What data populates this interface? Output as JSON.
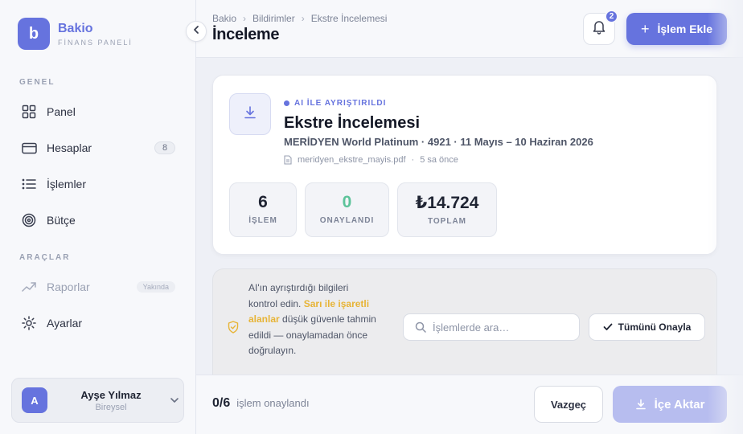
{
  "brand": {
    "logo_letter": "b",
    "name": "Bakio",
    "subtitle": "FİNANS PANELİ",
    "accent": "#6673de"
  },
  "sidebar": {
    "section_general": "GENEL",
    "section_tools": "ARAÇLAR",
    "items": [
      {
        "label": "Panel",
        "icon": "grid-icon"
      },
      {
        "label": "Hesaplar",
        "icon": "card-icon",
        "badge": "8"
      },
      {
        "label": "İşlemler",
        "icon": "list-icon"
      },
      {
        "label": "Bütçe",
        "icon": "target-icon"
      },
      {
        "label": "Raporlar",
        "icon": "trend-icon",
        "badge": "Yakında",
        "disabled": true
      },
      {
        "label": "Ayarlar",
        "icon": "gear-icon"
      }
    ]
  },
  "user": {
    "initial": "A",
    "name": "Ayşe Yılmaz",
    "role": "Bireysel"
  },
  "header": {
    "breadcrumb": [
      "Bakio",
      "Bildirimler",
      "Ekstre İncelemesi"
    ],
    "title": "İnceleme",
    "notification_count": "2",
    "add_label": "İşlem Ekle"
  },
  "statement": {
    "ai_tag": "AI İLE AYRIŞTIRILDI",
    "title": "Ekstre İncelemesi",
    "subtitle": "MERİDYEN World Platinum · 4921 · 11 Mayıs – 10 Haziran 2026",
    "file_name": "meridyen_ekstre_mayis.pdf",
    "file_time": "5 sa önce",
    "stats": [
      {
        "value": "6",
        "label": "İŞLEM",
        "color": "#1f2433"
      },
      {
        "value": "0",
        "label": "ONAYLANDI",
        "color": "#5cc39a"
      },
      {
        "value": "₺14.724",
        "label": "TOPLAM",
        "color": "#1f2433"
      }
    ]
  },
  "review": {
    "text_before": "AI'ın ayrıştırdığı bilgileri kontrol edin. ",
    "text_highlight": "Sarı ile işaretli alanlar",
    "text_after": " düşük güvenle tahmin edildi — onaylamadan önce doğrulayın.",
    "search_placeholder": "İşlemlerde ara…",
    "approve_all_label": "Tümünü Onayla"
  },
  "footer": {
    "progress_count": "0/6",
    "progress_label": "işlem onaylandı",
    "cancel_label": "Vazgeç",
    "import_label": "İçe Aktar"
  }
}
